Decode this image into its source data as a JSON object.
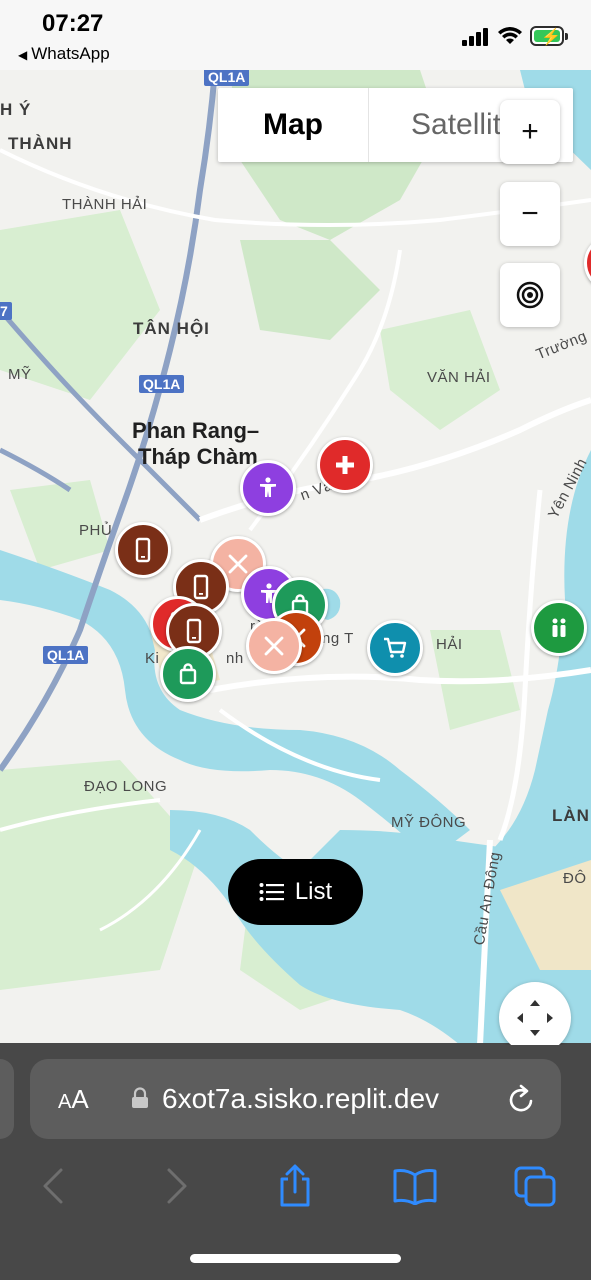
{
  "status_bar": {
    "time": "07:27",
    "back_app": "WhatsApp",
    "battery_charging": true
  },
  "map": {
    "map_type": {
      "options": [
        "Map",
        "Satellite"
      ],
      "selected": "Map"
    },
    "controls": {
      "zoom_in": "+",
      "zoom_out": "−"
    },
    "place_labels": {
      "h_y": "H Ý",
      "thanh": "THÀNH",
      "thanh_hai": "THÀNH HẢI",
      "tan_hoi": "TÂN HỘI",
      "my": "MỸ",
      "van_hai": "VĂN HẢI",
      "phan_rang": "Phan Rang–",
      "thap_cham": "Tháp Chàm",
      "phu": "PHỦ",
      "hai": "HẢI",
      "dao_long": "ĐẠO LONG",
      "my_dong": "MỸ ĐÔNG",
      "lan": "LÀN",
      "do": "ĐÔ",
      "truong": "Trường",
      "yen_ninh": "Yên Ninh",
      "cau_an_dong": "Cầu An Đông",
      "ki": "Ki",
      "nh": "nh",
      "rot": "rời",
      "ng_t": "ng T",
      "n_va": "n Vă"
    },
    "highway_shields": {
      "top": "QL1A",
      "mid": "QL1A",
      "left": "QL1A",
      "edge": "7"
    },
    "markers": [
      {
        "icon": "medical-cross",
        "color": "#e02a2a"
      },
      {
        "icon": "accessibility",
        "color": "#8e3fe0"
      },
      {
        "icon": "phone",
        "color": "#7a2f17"
      },
      {
        "icon": "utensils",
        "color": "#f4b3a3"
      },
      {
        "icon": "phone",
        "color": "#7a2f17"
      },
      {
        "icon": "accessibility",
        "color": "#8e3fe0"
      },
      {
        "icon": "shopping-bag",
        "color": "#1e9a5a"
      },
      {
        "icon": "utensils",
        "color": "#c2410c"
      },
      {
        "icon": "phone",
        "color": "#e02a2a"
      },
      {
        "icon": "phone",
        "color": "#7a2f17"
      },
      {
        "icon": "utensils",
        "color": "#f4b3a3"
      },
      {
        "icon": "shopping-bag",
        "color": "#1e9a5a"
      },
      {
        "icon": "shopping-cart",
        "color": "#0f8fad"
      },
      {
        "icon": "people",
        "color": "#1e9a40"
      },
      {
        "icon": "marker-partial",
        "color": "#e02a2a"
      }
    ],
    "list_button": "List"
  },
  "safari": {
    "aa_label": "AA",
    "url": "6xot7a.sisko.replit.dev"
  }
}
